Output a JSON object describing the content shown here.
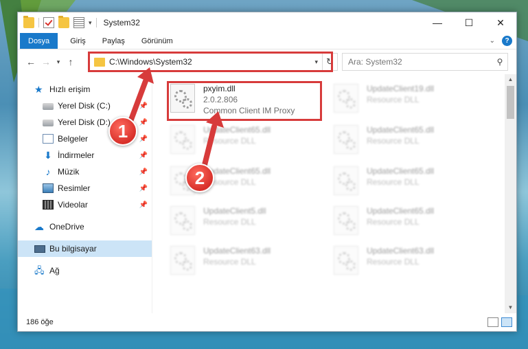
{
  "window": {
    "title": "System32",
    "controls": {
      "minimize": "—",
      "maximize": "☐",
      "close": "✕"
    }
  },
  "ribbon": {
    "tabs": [
      {
        "label": "Dosya",
        "active": true
      },
      {
        "label": "Giriş"
      },
      {
        "label": "Paylaş"
      },
      {
        "label": "Görünüm"
      }
    ],
    "help_label": "?"
  },
  "address": {
    "path": "C:\\Windows\\System32",
    "search_placeholder": "Ara: System32"
  },
  "sidebar": {
    "quick_access": "Hızlı erişim",
    "pinned": [
      {
        "label": "Yerel Disk (C:)",
        "icon": "drive-icon"
      },
      {
        "label": "Yerel Disk (D:)",
        "icon": "drive-icon"
      },
      {
        "label": "Belgeler",
        "icon": "documents-icon"
      },
      {
        "label": "İndirmeler",
        "icon": "downloads-icon"
      },
      {
        "label": "Müzik",
        "icon": "music-icon"
      },
      {
        "label": "Resimler",
        "icon": "pictures-icon"
      },
      {
        "label": "Videolar",
        "icon": "videos-icon"
      }
    ],
    "onedrive": "OneDrive",
    "this_pc": "Bu bilgisayar",
    "network": "Ağ"
  },
  "files": {
    "highlighted": {
      "name": "pxyim.dll",
      "version": "2.0.2.806",
      "description": "Common Client IM Proxy"
    },
    "left_column": [
      {
        "name": "UpdateClient65.dll",
        "description": "Resource DLL"
      },
      {
        "name": "UpdateClient65.dll",
        "description": "Resource DLL"
      },
      {
        "name": "UpdateClient5.dll",
        "description": "Resource DLL"
      },
      {
        "name": "UpdateClient63.dll",
        "description": "Resource DLL"
      }
    ],
    "right_column": [
      {
        "name": "UpdateClient19.dll",
        "description": "Resource DLL"
      },
      {
        "name": "UpdateClient65.dll",
        "description": "Resource DLL"
      },
      {
        "name": "UpdateClient65.dll",
        "description": "Resource DLL"
      },
      {
        "name": "UpdateClient65.dll",
        "description": "Resource DLL"
      },
      {
        "name": "UpdateClient63.dll",
        "description": "Resource DLL"
      }
    ]
  },
  "status": {
    "item_count": "186 öğe"
  },
  "annotations": {
    "step1": "1",
    "step2": "2",
    "color": "#d73b3b"
  }
}
